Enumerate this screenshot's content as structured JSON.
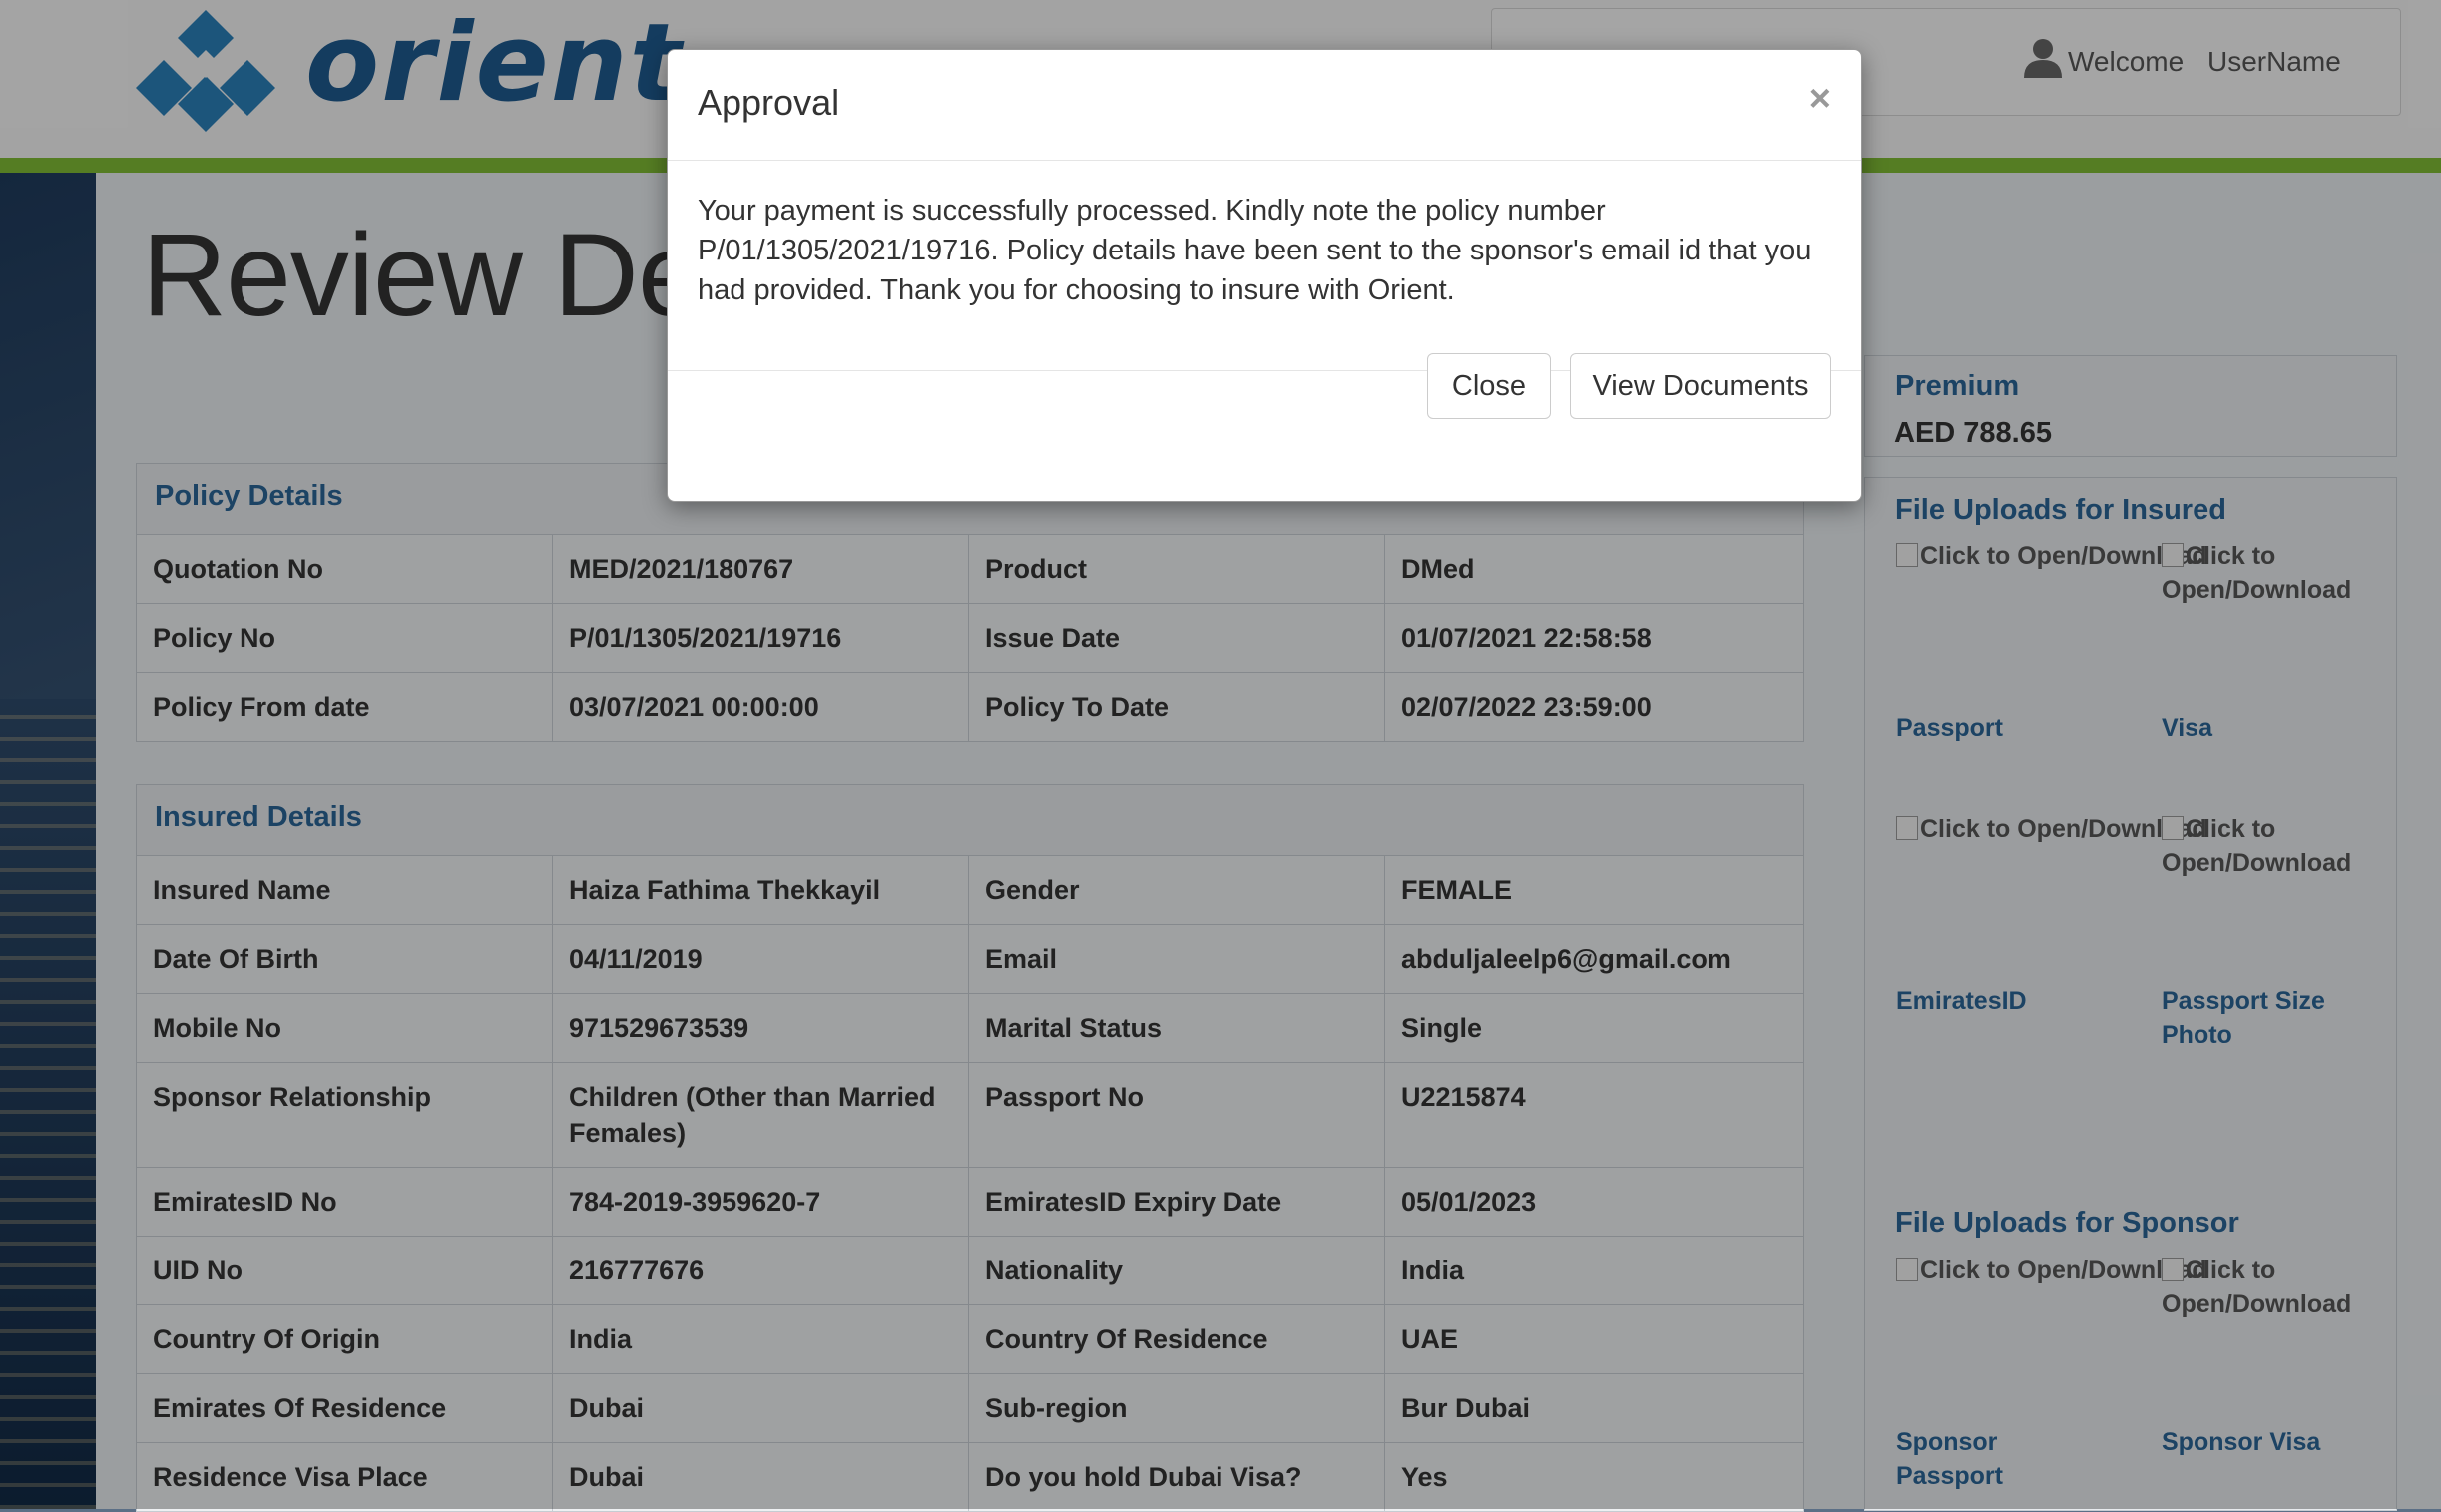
{
  "header": {
    "brand": "orient",
    "welcome": "Welcome",
    "username": "UserName"
  },
  "page": {
    "title": "Review Deta"
  },
  "policy_details": {
    "title": "Policy Details",
    "rows": [
      [
        "Quotation No",
        "MED/2021/180767",
        "Product",
        "DMed"
      ],
      [
        "Policy No",
        "P/01/1305/2021/19716",
        "Issue Date",
        "01/07/2021 22:58:58"
      ],
      [
        "Policy From date",
        "03/07/2021 00:00:00",
        "Policy To Date",
        "02/07/2022 23:59:00"
      ]
    ]
  },
  "insured_details": {
    "title": "Insured Details",
    "rows": [
      [
        "Insured Name",
        "Haiza Fathima Thekkayil",
        "Gender",
        "FEMALE"
      ],
      [
        "Date Of Birth",
        "04/11/2019",
        "Email",
        "abduljaleelp6@gmail.com"
      ],
      [
        "Mobile No",
        "971529673539",
        "Marital Status",
        "Single"
      ],
      [
        "Sponsor Relationship",
        "Children (Other than Married Females)",
        "Passport No",
        "U2215874"
      ],
      [
        "EmiratesID No",
        "784-2019-3959620-7",
        "EmiratesID Expiry Date",
        "05/01/2023"
      ],
      [
        "UID No",
        "216777676",
        "Nationality",
        "India"
      ],
      [
        "Country Of Origin",
        "India",
        "Country Of Residence",
        "UAE"
      ],
      [
        "Emirates Of Residence",
        "Dubai",
        "Sub-region",
        "Bur Dubai"
      ],
      [
        "Residence Visa Place",
        "Dubai",
        "Do you hold Dubai Visa?",
        "Yes"
      ]
    ]
  },
  "sidebar": {
    "premium_title": "Premium",
    "premium_value": "AED 788.65",
    "insured_uploads_title": "File Uploads for Insured",
    "sponsor_uploads_title": "File Uploads for Sponsor",
    "download_text": "Click to Open/Download",
    "insured_docs": [
      "Passport",
      "Visa",
      "EmiratesID",
      "Passport Size Photo"
    ],
    "sponsor_docs": [
      "Sponsor Passport",
      "Sponsor Visa"
    ]
  },
  "modal": {
    "title": "Approval",
    "close_x": "×",
    "message": "Your payment is successfully processed. Kindly note the policy number P/01/1305/2021/19716. Policy details have been sent to the sponsor's email id that you had provided. Thank you for choosing to insure with Orient.",
    "close_label": "Close",
    "view_docs_label": "View Documents"
  },
  "colors": {
    "accent": "#2a6496",
    "brand_green": "#7fbb35",
    "brand_blue": "#1e5a8e"
  }
}
